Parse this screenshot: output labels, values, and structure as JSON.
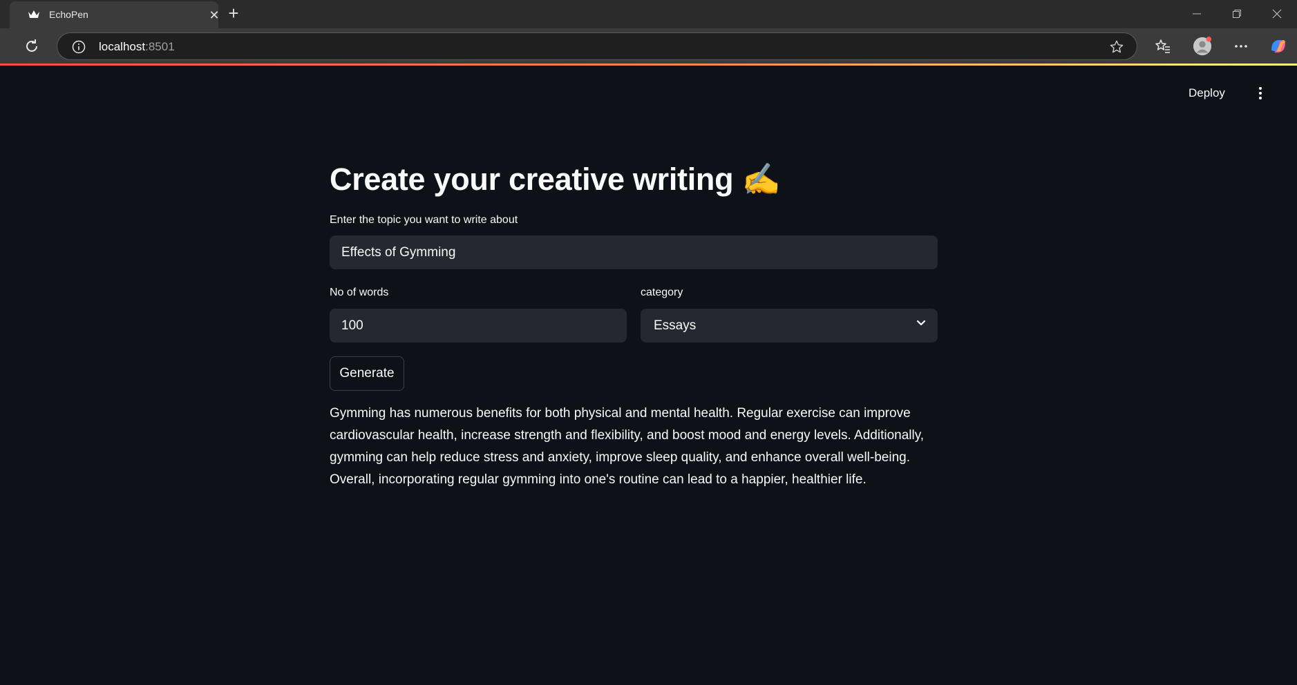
{
  "browser": {
    "tab_title": "EchoPen",
    "url_host": "localhost",
    "url_port": ":8501",
    "icons": [
      "streamlit-crown-icon",
      "close-icon",
      "plus-icon",
      "reload-icon",
      "info-icon",
      "star-icon",
      "favorites-icon",
      "profile-avatar",
      "more-icon",
      "copilot-icon",
      "minimize-icon",
      "restore-icon",
      "window-close-icon"
    ]
  },
  "app": {
    "deploy_label": "Deploy",
    "title": "Create your creative writing ✍️",
    "topic": {
      "label": "Enter the topic you want to write about",
      "value": "Effects of Gymming"
    },
    "words": {
      "label": "No of words",
      "value": "100"
    },
    "category": {
      "label": "category",
      "value": "Essays"
    },
    "generate_label": "Generate",
    "output_text": "Gymming has numerous benefits for both physical and mental health. Regular exercise can improve cardiovascular health, increase strength and flexibility, and boost mood and energy levels. Additionally, gymming can help reduce stress and anxiety, improve sleep quality, and enhance overall well-being. Overall, incorporating regular gymming into one's routine can lead to a happier, healthier life."
  },
  "colors": {
    "background": "#0e1117",
    "input_bg": "#262730",
    "text": "#fafafa",
    "accent_start": "#ff4b4b",
    "accent_end": "#fffd80"
  }
}
